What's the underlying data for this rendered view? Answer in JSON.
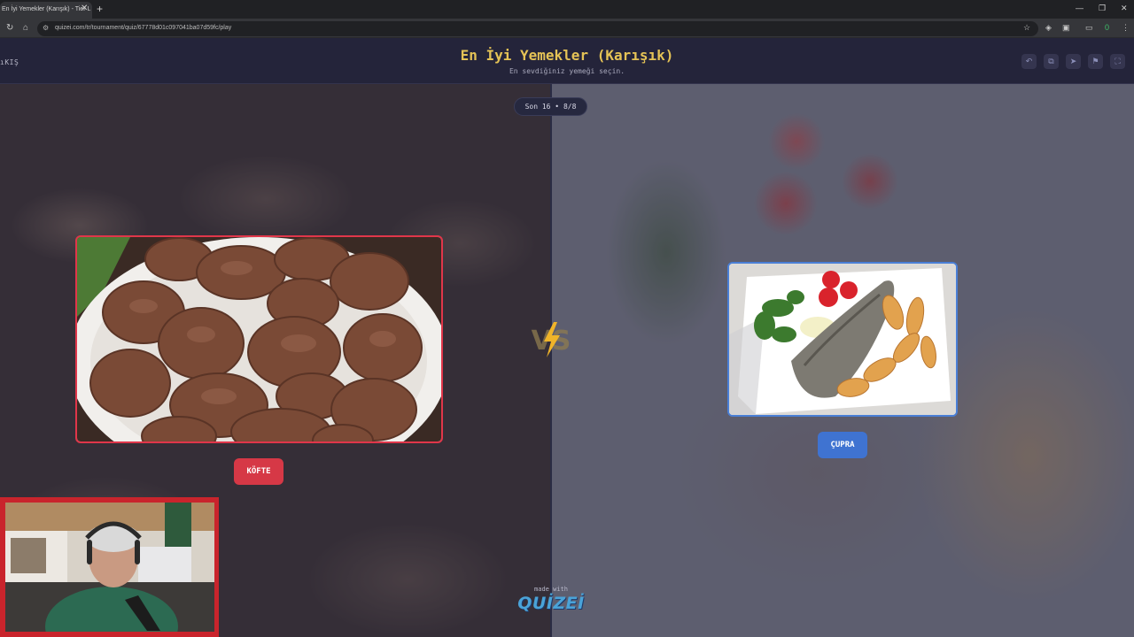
{
  "browser": {
    "tab_title": "En İyi Yemekler (Karışık) - Tier L",
    "tab_close": "✕",
    "new_tab": "+",
    "url": "quizei.com/tr/tournament/quiz/67778d01c097041ba07d59fc/play",
    "window_controls": [
      "—",
      "❐",
      "✕"
    ],
    "extension_badge": "0"
  },
  "app": {
    "exit_label": "ıKIŞ",
    "title": "En İyi Yemekler (Karışık)",
    "subtitle": "En sevdiğiniz yemeği seçin."
  },
  "round": {
    "label": "Son 16 • 8/8"
  },
  "choices": {
    "left": {
      "label": "KÖFTE",
      "accent": "#d63846"
    },
    "right": {
      "label": "ÇUPRA",
      "accent": "#3f73d1"
    }
  },
  "versus": {
    "label": "VS"
  },
  "footer": {
    "made_with": "made with",
    "brand": "QUİZEİ"
  }
}
